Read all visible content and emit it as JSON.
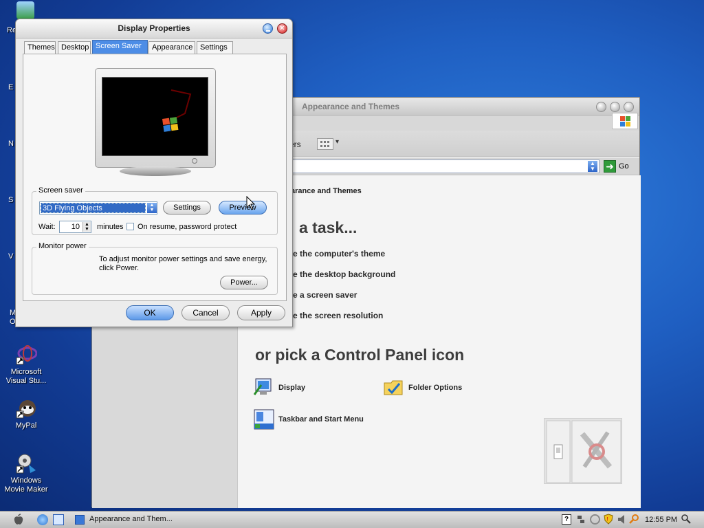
{
  "desktop_icons": [
    {
      "label": "Microsoft Visual Stu..."
    },
    {
      "label": "MyPal"
    },
    {
      "label": "Windows Movie Maker"
    }
  ],
  "control_panel": {
    "title": "Appearance and Themes",
    "toolbar_partial_label": "ers",
    "go_label": "Go",
    "address_fragment": "arance and Themes",
    "task_heading_partial": "a task...",
    "tasks": [
      "e the computer's theme",
      "e the desktop background",
      "e a screen saver",
      "e the screen resolution"
    ],
    "icon_heading": "or pick a Control Panel icon",
    "icons": [
      {
        "label": "Display",
        "icon": "display-icon"
      },
      {
        "label": "Folder Options",
        "icon": "folder-options-icon"
      },
      {
        "label": "Taskbar and Start Menu",
        "icon": "taskbar-icon"
      }
    ]
  },
  "display_properties": {
    "title": "Display Properties",
    "tabs": [
      "Themes",
      "Desktop",
      "Screen Saver",
      "Appearance",
      "Settings"
    ],
    "active_tab": "Screen Saver",
    "screen_saver": {
      "group_label": "Screen saver",
      "selected": "3D Flying Objects",
      "settings_label": "Settings",
      "preview_label": "Preview",
      "wait_label": "Wait:",
      "wait_value": "10",
      "minutes_label": "minutes",
      "resume_label": "On resume, password protect",
      "resume_checked": false
    },
    "monitor_power": {
      "group_label": "Monitor power",
      "text": "To adjust monitor power settings and save energy, click Power.",
      "power_label": "Power..."
    },
    "buttons": {
      "ok": "OK",
      "cancel": "Cancel",
      "apply": "Apply"
    }
  },
  "taskbar": {
    "task_button": "Appearance and Them...",
    "clock": "12:55 PM"
  }
}
